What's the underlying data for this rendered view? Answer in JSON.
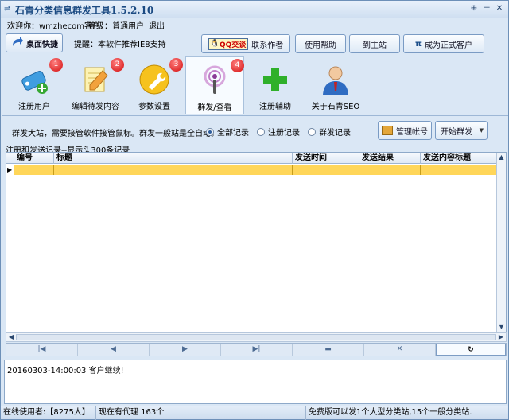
{
  "window": {
    "title": "石青分类信息群发工具1.5.2.10",
    "controls": [
      "⊕",
      "－",
      "✕"
    ]
  },
  "userbar": {
    "welcome": "欢迎你：wmzhecom客户",
    "level": "等级：普通用户",
    "logout": "退出"
  },
  "topbar": {
    "desktop_shortcut": "桌面快捷",
    "reminder": "提醒：本软件推荐IE8支持",
    "qq_label": "QQ交谈",
    "contact_author": "联系作者",
    "help": "使用帮助",
    "main_site": "到主站",
    "become_pro": "成为正式客户"
  },
  "tools": [
    {
      "label": "注册用户",
      "badge": "1",
      "icon": "tag-add-icon"
    },
    {
      "label": "编辑待发内容",
      "badge": "2",
      "icon": "edit-document-icon"
    },
    {
      "label": "参数设置",
      "badge": "3",
      "icon": "wrench-icon"
    },
    {
      "label": "群发/查看",
      "badge": "4",
      "icon": "broadcast-icon"
    },
    {
      "label": "注册辅助",
      "badge": "",
      "icon": "green-plus-icon"
    },
    {
      "label": "关于石青SEO",
      "badge": "",
      "icon": "person-icon"
    }
  ],
  "options": {
    "description": "群发大站，需要接管软件接管鼠标。群发一般站是全自动。",
    "radio_all": "全部记录",
    "radio_register": "注册记录",
    "radio_broadcast": "群发记录",
    "manage_accounts": "管理帐号",
    "start_broadcast": "开始群发"
  },
  "grid": {
    "caption": "注册和发送记录--显示头300条记录",
    "columns": [
      "编号",
      "标题",
      "发送时间",
      "发送结果",
      "发送内容标题"
    ]
  },
  "navigator": [
    "|◀",
    "◀",
    "▶",
    "▶|",
    "▬",
    "✕",
    "↻"
  ],
  "log": {
    "line": "20160303-14:00:03  客户继续!"
  },
  "status": {
    "user_count": "在线使用者:【8275人】",
    "proxy": "现在有代理 163个",
    "notice": "免费版可以发1个大型分类站,15个一般分类站."
  },
  "colors": {
    "selected_row": "#ffd659",
    "window_bg": "#dae7f5",
    "title_text": "#1b4a82"
  }
}
